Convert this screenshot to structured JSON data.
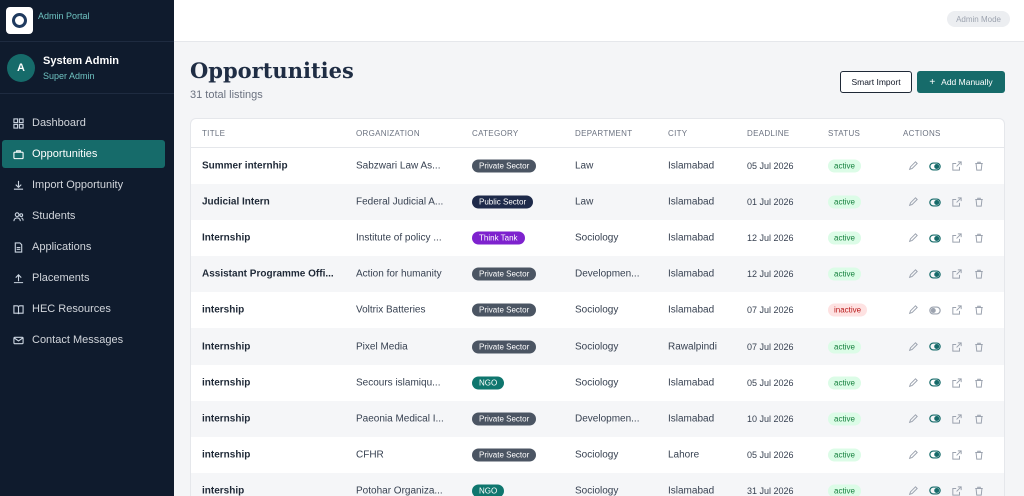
{
  "brand": {
    "portal_label": "Admin Portal"
  },
  "user": {
    "initial": "A",
    "name": "System Admin",
    "role": "Super Admin"
  },
  "nav": [
    {
      "label": "Dashboard",
      "icon": "grid-icon"
    },
    {
      "label": "Opportunities",
      "icon": "briefcase-icon",
      "active": true
    },
    {
      "label": "Import Opportunity",
      "icon": "download-icon"
    },
    {
      "label": "Students",
      "icon": "users-icon"
    },
    {
      "label": "Applications",
      "icon": "document-icon"
    },
    {
      "label": "Placements",
      "icon": "upload-icon"
    },
    {
      "label": "HEC Resources",
      "icon": "book-icon"
    },
    {
      "label": "Contact Messages",
      "icon": "mail-icon"
    }
  ],
  "topbar": {
    "mode_label": "Admin Mode"
  },
  "page": {
    "title": "Opportunities",
    "subtitle": "31 total listings"
  },
  "buttons": {
    "smart_import": "Smart Import",
    "add_manually": "Add Manually"
  },
  "table": {
    "columns": [
      "TITLE",
      "ORGANIZATION",
      "CATEGORY",
      "DEPARTMENT",
      "CITY",
      "DEADLINE",
      "STATUS",
      "ACTIONS"
    ],
    "rows": [
      {
        "title": "Summer internhip",
        "organization": "Sabzwari Law As...",
        "category": "Private Sector",
        "department": "Law",
        "city": "Islamabad",
        "deadline": "05 Jul 2026",
        "status": "active"
      },
      {
        "title": "Judicial Intern",
        "organization": "Federal Judicial A...",
        "category": "Public Sector",
        "department": "Law",
        "city": "Islamabad",
        "deadline": "01 Jul 2026",
        "status": "active"
      },
      {
        "title": "Internship",
        "organization": "Institute of policy ...",
        "category": "Think Tank",
        "department": "Sociology",
        "city": "Islamabad",
        "deadline": "12 Jul 2026",
        "status": "active"
      },
      {
        "title": "Assistant Programme Offi...",
        "organization": "Action for humanity",
        "category": "Private Sector",
        "department": "Developmen...",
        "city": "Islamabad",
        "deadline": "12 Jul 2026",
        "status": "active"
      },
      {
        "title": "intership",
        "organization": "Voltrix Batteries",
        "category": "Private Sector",
        "department": "Sociology",
        "city": "Islamabad",
        "deadline": "07 Jul 2026",
        "status": "inactive"
      },
      {
        "title": "Internship",
        "organization": "Pixel Media",
        "category": "Private Sector",
        "department": "Sociology",
        "city": "Rawalpindi",
        "deadline": "07 Jul 2026",
        "status": "active"
      },
      {
        "title": "internship",
        "organization": "Secours islamiqu...",
        "category": "NGO",
        "department": "Sociology",
        "city": "Islamabad",
        "deadline": "05 Jul 2026",
        "status": "active"
      },
      {
        "title": "internship",
        "organization": "Paeonia Medical I...",
        "category": "Private Sector",
        "department": "Developmen...",
        "city": "Islamabad",
        "deadline": "10 Jul 2026",
        "status": "active"
      },
      {
        "title": "internship",
        "organization": "CFHR",
        "category": "Private Sector",
        "department": "Sociology",
        "city": "Lahore",
        "deadline": "05 Jul 2026",
        "status": "active"
      },
      {
        "title": "intership",
        "organization": "Potohar Organiza...",
        "category": "NGO",
        "department": "Sociology",
        "city": "Islamabad",
        "deadline": "31 Jul 2026",
        "status": "active"
      }
    ]
  },
  "category_colors": {
    "Private Sector": "#4b5563",
    "Public Sector": "#1e2a4a",
    "Think Tank": "#7e22ce",
    "NGO": "#0f766e"
  },
  "colors": {
    "accent": "#166b6a",
    "sidebar_bg": "#0f1b2d"
  }
}
